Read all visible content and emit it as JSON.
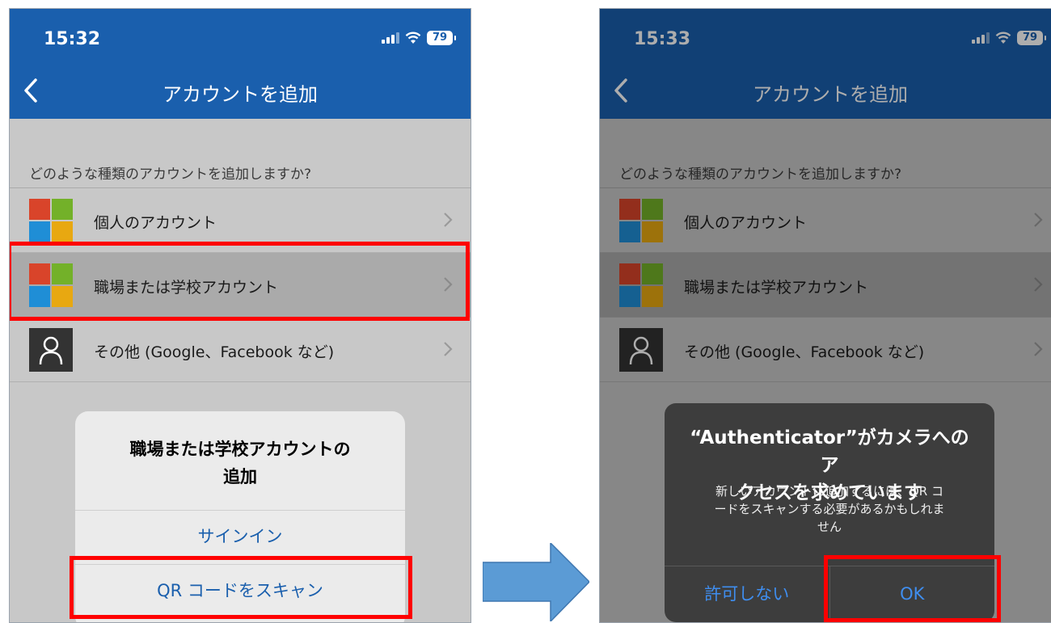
{
  "colors": {
    "header": "#1a5fad",
    "highlight": "#ff0000",
    "link": "#1a5fad",
    "alert_button": "#3f8ef0",
    "arrow": "#5b9bd5"
  },
  "left_screen": {
    "status": {
      "time": "15:32",
      "battery": "79"
    },
    "header": {
      "title": "アカウントを追加",
      "back_icon": "chevron-left-icon"
    },
    "question": "どのような種類のアカウントを追加しますか?",
    "accounts": [
      {
        "label": "個人のアカウント",
        "icon": "microsoft-logo-icon"
      },
      {
        "label": "職場または学校アカウント",
        "icon": "microsoft-logo-icon",
        "selected": true
      },
      {
        "label": "その他 (Google、Facebook など)",
        "icon": "person-icon"
      }
    ],
    "sheet": {
      "title_line1": "職場または学校アカウントの",
      "title_line2": "追加",
      "sign_in": "サインイン",
      "scan_qr": "QR コードをスキャン"
    }
  },
  "right_screen": {
    "status": {
      "time": "15:33",
      "battery": "79"
    },
    "header": {
      "title": "アカウントを追加",
      "back_icon": "chevron-left-icon"
    },
    "question": "どのような種類のアカウントを追加しますか?",
    "accounts": [
      {
        "label": "個人のアカウント",
        "icon": "microsoft-logo-icon"
      },
      {
        "label": "職場または学校アカウント",
        "icon": "microsoft-logo-icon",
        "selected": true
      },
      {
        "label": "その他 (Google、Facebook など)",
        "icon": "person-icon"
      }
    ],
    "alert": {
      "title_line1": "“Authenticator”がカメラへのア",
      "title_line2": "クセスを求めています",
      "message_line1": "新しいアカウントに追加するには、QR コ",
      "message_line2": "ードをスキャンする必要があるかもしれま",
      "message_line3": "せん",
      "deny": "許可しない",
      "ok": "OK"
    }
  }
}
